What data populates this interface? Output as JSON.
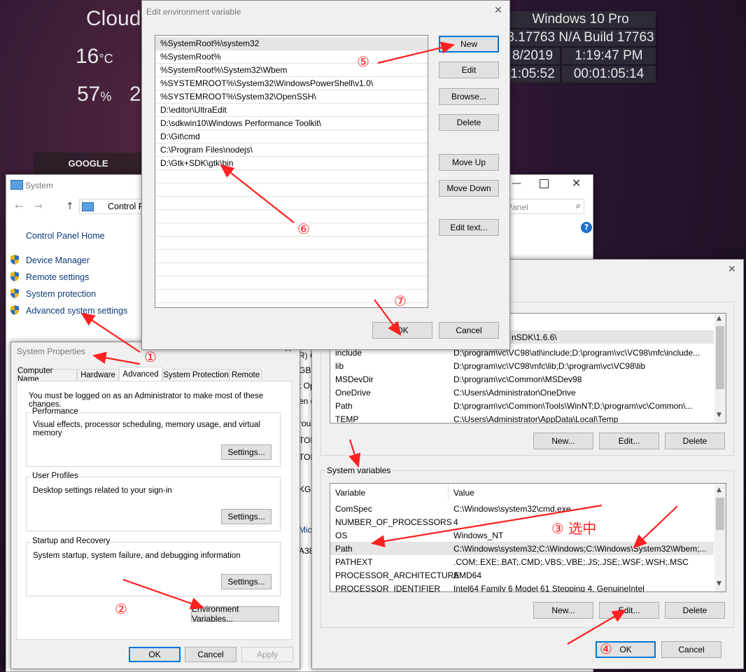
{
  "desktop": {
    "weather": {
      "condition": "Cloudy",
      "temp": "16",
      "temp_unit": "°C",
      "humidity": "57",
      "humidity_unit": "%",
      "fragment": "2"
    },
    "google_label": "GOOGLE",
    "wininfo": {
      "os": "Windows 10 Pro",
      "build": "3.17763 N/A Build 17763",
      "date": "8/2019",
      "time": "1:19:47 PM",
      "uptime_left": "1:05:52",
      "uptime_right": "00:01:05:14"
    }
  },
  "system_window": {
    "title": "System",
    "address": "Control P",
    "search_placeholder": "Panel",
    "home_link": "Control Panel Home",
    "links": [
      "Device Manager",
      "Remote settings",
      "System protection",
      "Advanced system settings"
    ],
    "partial_text": [
      "R) C",
      "GB",
      "t Op",
      "en o",
      "roup",
      "TOR",
      "TOR",
      "KGR",
      "Micro",
      "A38"
    ]
  },
  "sysprops": {
    "title": "System Properties",
    "tabs": [
      "Computer Name",
      "Hardware",
      "Advanced",
      "System Protection",
      "Remote"
    ],
    "active_tab": "Advanced",
    "admin_note": "You must be logged on as an Administrator to make most of these changes.",
    "performance": {
      "title": "Performance",
      "desc": "Visual effects, processor scheduling, memory usage, and virtual memory",
      "button": "Settings..."
    },
    "user_profiles": {
      "title": "User Profiles",
      "desc": "Desktop settings related to your sign-in",
      "button": "Settings..."
    },
    "startup": {
      "title": "Startup and Recovery",
      "desc": "System startup, system failure, and debugging information",
      "button": "Settings..."
    },
    "env_button": "Environment Variables...",
    "ok": "OK",
    "cancel": "Cancel",
    "apply": "Apply"
  },
  "envvars": {
    "user_vars": [
      {
        "name": "",
        "value": "nSDK\\1.6.6\\"
      },
      {
        "name": "include",
        "value": "D:\\program\\vc\\VC98\\atl\\include;D:\\program\\vc\\VC98\\mfc\\include..."
      },
      {
        "name": "lib",
        "value": "D:\\program\\vc\\VC98\\mfc\\lib;D:\\program\\vc\\VC98\\lib"
      },
      {
        "name": "MSDevDir",
        "value": "D:\\program\\vc\\Common\\MSDev98"
      },
      {
        "name": "OneDrive",
        "value": "C:\\Users\\Administrator\\OneDrive"
      },
      {
        "name": "Path",
        "value": "D:\\program\\vc\\Common\\Tools\\WinNT;D:\\program\\vc\\Common\\..."
      },
      {
        "name": "TEMP",
        "value": "C:\\Users\\Administrator\\AppData\\Local\\Temp"
      }
    ],
    "user_buttons": {
      "new": "New...",
      "edit": "Edit...",
      "delete": "Delete"
    },
    "system_group_title": "System variables",
    "col_variable": "Variable",
    "col_value": "Value",
    "system_vars": [
      {
        "name": "ComSpec",
        "value": "C:\\Windows\\system32\\cmd.exe"
      },
      {
        "name": "NUMBER_OF_PROCESSORS",
        "value": "4"
      },
      {
        "name": "OS",
        "value": "Windows_NT"
      },
      {
        "name": "Path",
        "value": "C:\\Windows\\system32;C:\\Windows;C:\\Windows\\System32\\Wbem;..."
      },
      {
        "name": "PATHEXT",
        "value": ".COM;.EXE;.BAT;.CMD;.VBS;.VBE;.JS;.JSE;.WSF;.WSH;.MSC"
      },
      {
        "name": "PROCESSOR_ARCHITECTURE",
        "value": "AMD64"
      },
      {
        "name": "PROCESSOR_IDENTIFIER",
        "value": "Intel64 Family 6 Model 61 Stepping 4, GenuineIntel"
      }
    ],
    "selected_system_var": "Path",
    "system_buttons": {
      "new": "New...",
      "edit": "Edit...",
      "delete": "Delete"
    },
    "ok": "OK",
    "cancel": "Cancel"
  },
  "editdlg": {
    "title": "Edit environment variable",
    "entries": [
      "%SystemRoot%\\system32",
      "%SystemRoot%",
      "%SystemRoot%\\System32\\Wbem",
      "%SYSTEMROOT%\\System32\\WindowsPowerShell\\v1.0\\",
      "%SYSTEMROOT%\\System32\\OpenSSH\\",
      "D:\\editor\\UltraEdit",
      "D:\\sdkwin10\\Windows Performance Toolkit\\",
      "D:\\Git\\cmd",
      "C:\\Program Files\\nodejs\\",
      "D:\\Gtk+SDK\\gtk\\bin"
    ],
    "buttons": {
      "new": "New",
      "edit": "Edit",
      "browse": "Browse...",
      "delete": "Delete",
      "move_up": "Move Up",
      "move_down": "Move Down",
      "edit_text": "Edit text..."
    },
    "ok": "OK",
    "cancel": "Cancel"
  },
  "annotations": {
    "step1": "①",
    "step2": "②",
    "step3": "③ 选中",
    "step4": "④",
    "step5": "⑤",
    "step6": "⑥",
    "step7": "⑦",
    "color": "#ff2020"
  },
  "colors": {
    "accent": "#0078d7",
    "link": "#0d3a7a",
    "selected_row": "#e5e5e5"
  }
}
